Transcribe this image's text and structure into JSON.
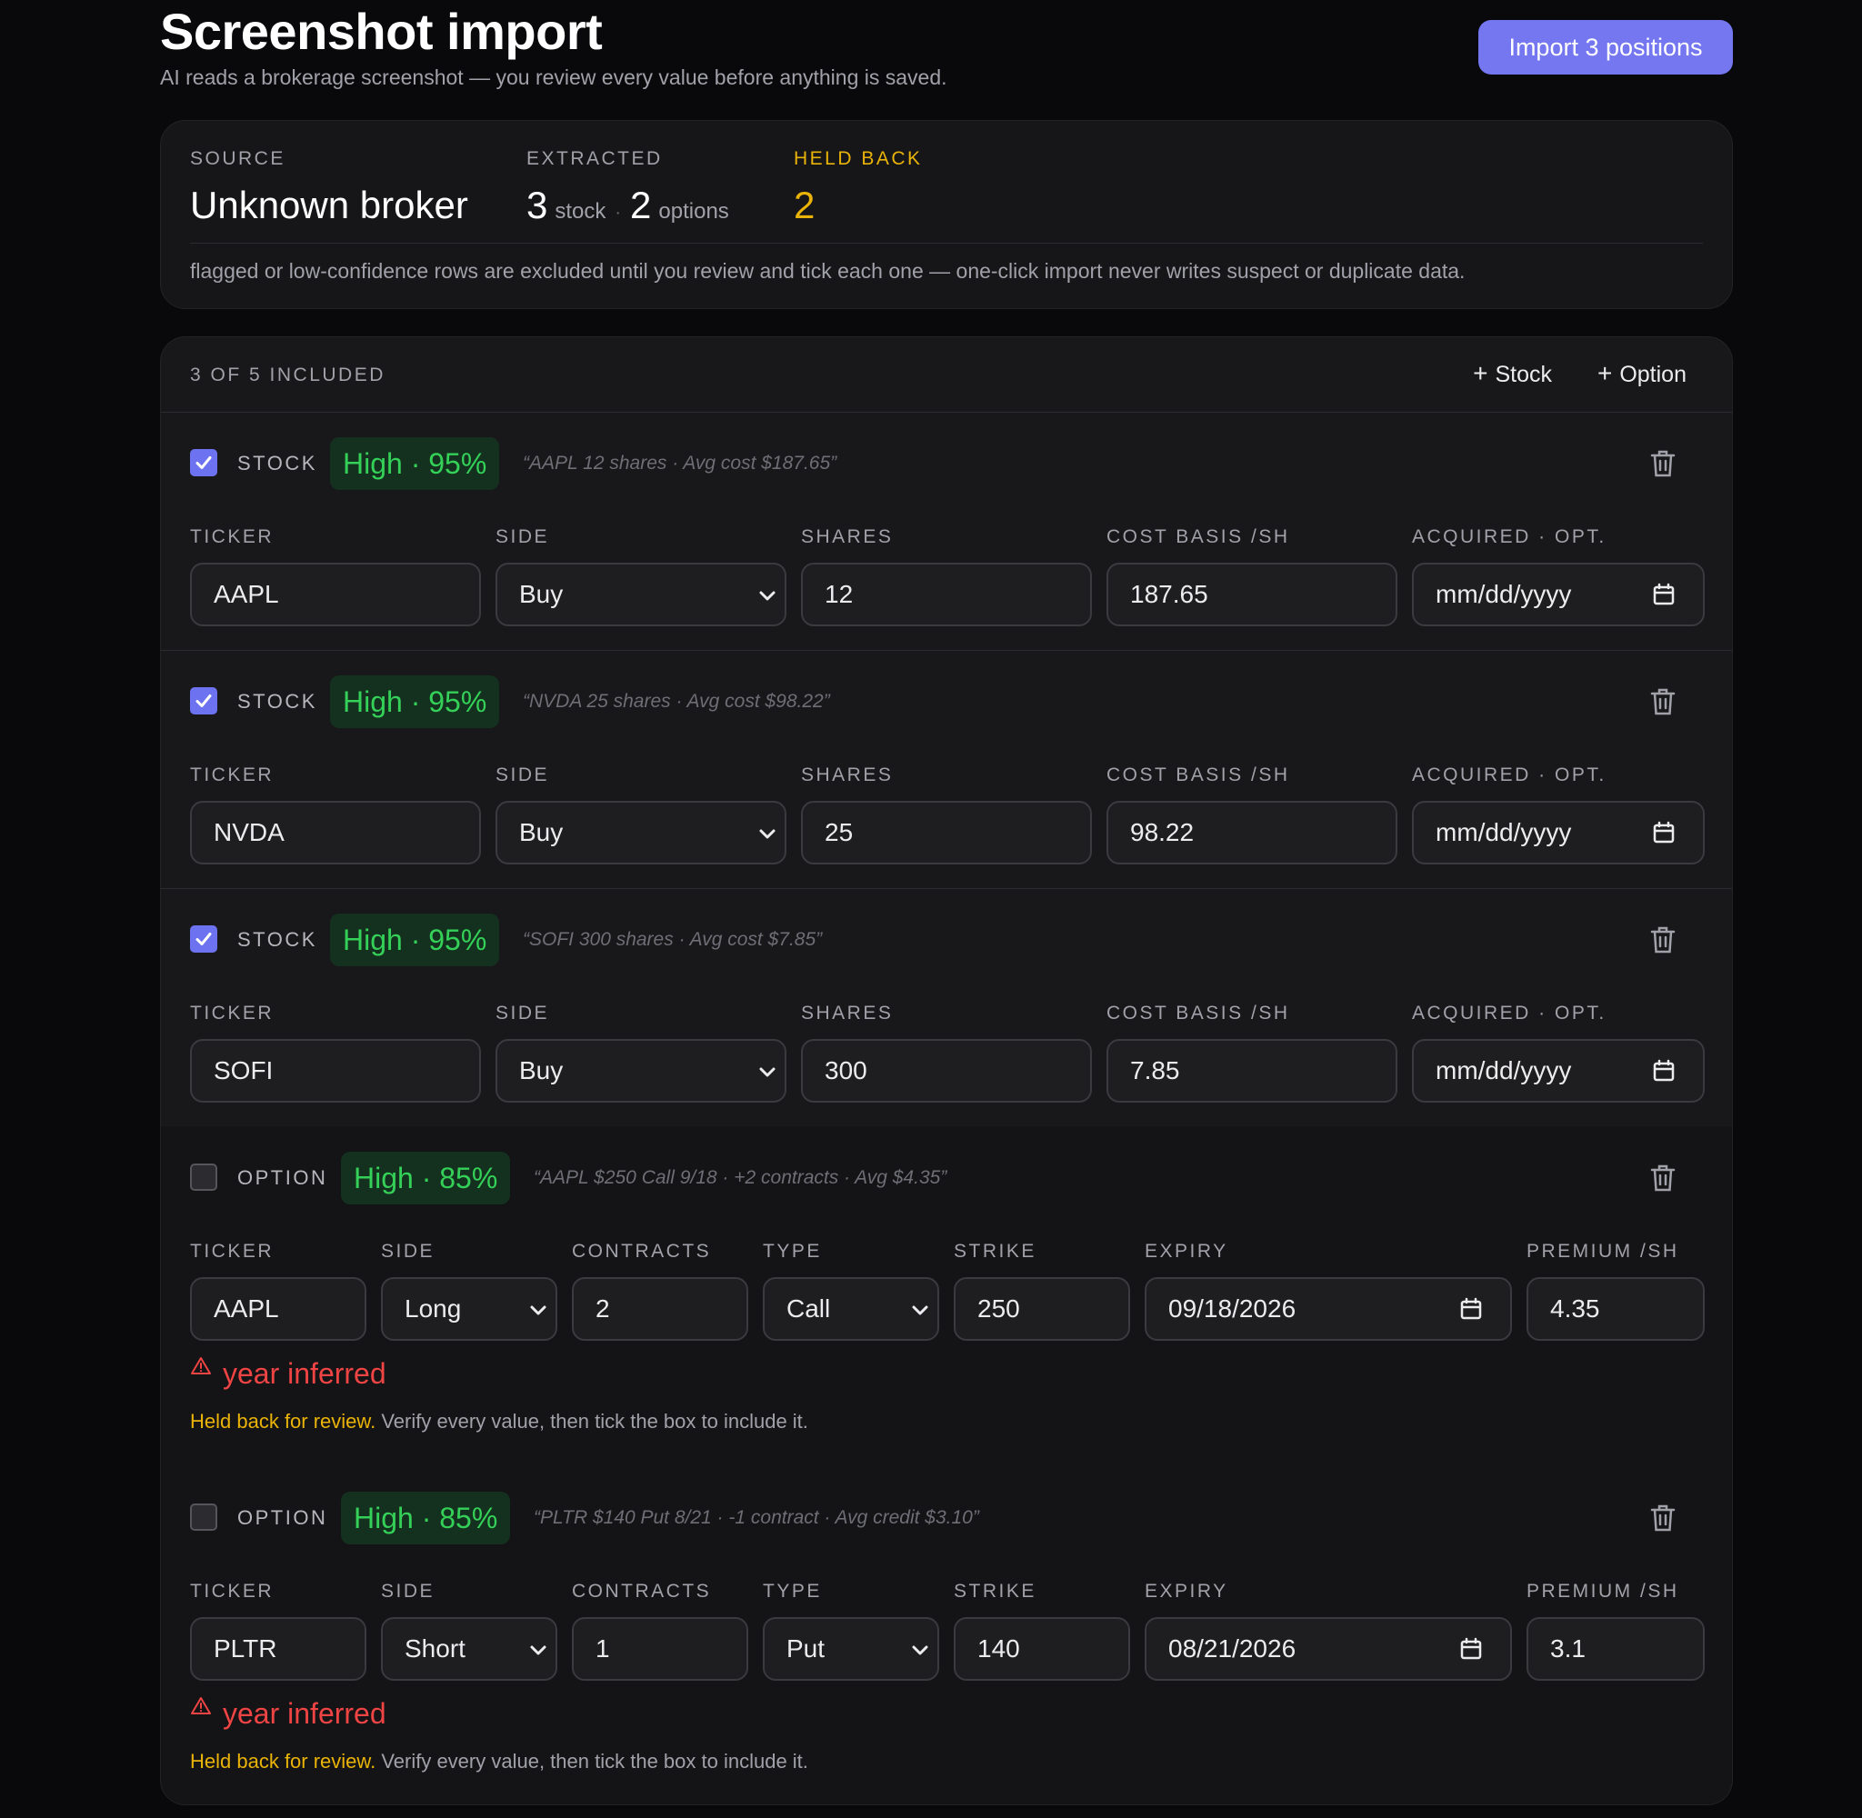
{
  "header": {
    "title": "Screenshot import",
    "subtitle": "AI reads a brokerage screenshot — you review every value before anything is saved.",
    "import_button": "Import 3 positions"
  },
  "summary": {
    "source_label": "SOURCE",
    "source_value": "Unknown broker",
    "extracted_label": "EXTRACTED",
    "stock_count": "3",
    "stock_word": "stock",
    "separator": "·",
    "option_count": "2",
    "option_word": "options",
    "held_label": "HELD BACK",
    "held_value": "2",
    "note": "flagged or low-confidence rows are excluded until you review and tick each one — one-click import never writes suspect or duplicate data."
  },
  "rows_header": {
    "included": "3 OF 5 INCLUDED",
    "plus": "+",
    "add_stock": "Stock",
    "add_option": "Option"
  },
  "stock_labels": {
    "ticker": "TICKER",
    "side": "SIDE",
    "shares": "SHARES",
    "cost": "COST BASIS /SH",
    "acquired": "ACQUIRED · OPT."
  },
  "option_labels": {
    "ticker": "TICKER",
    "side": "SIDE",
    "contracts": "CONTRACTS",
    "type": "TYPE",
    "strike": "STRIKE",
    "expiry": "EXPIRY",
    "premium": "PREMIUM /SH"
  },
  "stocks": [
    {
      "checked": true,
      "kind": "STOCK",
      "confidence": "High · 95%",
      "quote": "“AAPL 12 shares · Avg cost $187.65”",
      "ticker": "AAPL",
      "side": "Buy",
      "shares": "12",
      "cost": "187.65",
      "acquired": "mm/dd/yyyy"
    },
    {
      "checked": true,
      "kind": "STOCK",
      "confidence": "High · 95%",
      "quote": "“NVDA 25 shares · Avg cost $98.22”",
      "ticker": "NVDA",
      "side": "Buy",
      "shares": "25",
      "cost": "98.22",
      "acquired": "mm/dd/yyyy"
    },
    {
      "checked": true,
      "kind": "STOCK",
      "confidence": "High · 95%",
      "quote": "“SOFI 300 shares · Avg cost $7.85”",
      "ticker": "SOFI",
      "side": "Buy",
      "shares": "300",
      "cost": "7.85",
      "acquired": "mm/dd/yyyy"
    }
  ],
  "options": [
    {
      "checked": false,
      "kind": "OPTION",
      "confidence": "High · 85%",
      "quote": "“AAPL $250 Call 9/18 · +2 contracts · Avg $4.35”",
      "ticker": "AAPL",
      "side": "Long",
      "contracts": "2",
      "type": "Call",
      "strike": "250",
      "expiry": "09/18/2026",
      "premium": "4.35",
      "warning": "year inferred",
      "held_strong": "Held back for review.",
      "held_rest": " Verify every value, then tick the box to include it."
    },
    {
      "checked": false,
      "kind": "OPTION",
      "confidence": "High · 85%",
      "quote": "“PLTR $140 Put 8/21 · -1 contract · Avg credit $3.10”",
      "ticker": "PLTR",
      "side": "Short",
      "contracts": "1",
      "type": "Put",
      "strike": "140",
      "expiry": "08/21/2026",
      "premium": "3.1",
      "warning": "year inferred",
      "held_strong": "Held back for review.",
      "held_rest": " Verify every value, then tick the box to include it."
    }
  ],
  "colors": {
    "accent": "#7477f0",
    "confidence_green": "#34d058",
    "warning_red": "#ef4444",
    "held_amber": "#eab308"
  },
  "icons": {
    "checkbox_checked": "checkmark-icon",
    "delete": "trash-icon",
    "select": "chevron-down-icon",
    "date": "calendar-icon",
    "warning": "warning-triangle-icon"
  }
}
